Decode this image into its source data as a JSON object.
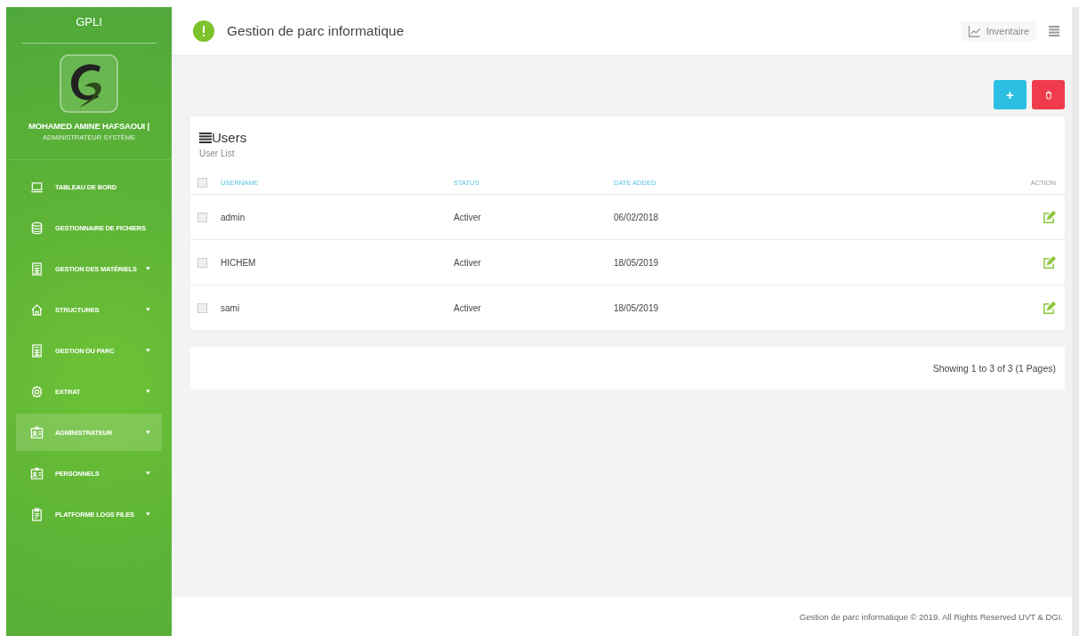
{
  "sidebar": {
    "brand": "GPLI",
    "user_name": "MOHAMED AMINE HAFSAOUI |",
    "user_role": "ADMINISTRATEUR SYSTÈME",
    "items": [
      {
        "label": "TABLEAU DE BORD",
        "kind": "laptop",
        "has_submenu": false,
        "selected": false
      },
      {
        "label": "GESTIONNAIRE DE FICHIERS",
        "kind": "database",
        "has_submenu": false,
        "selected": false
      },
      {
        "label": "GESTION DES MATÉRIELS",
        "kind": "calculator",
        "has_submenu": true,
        "selected": false
      },
      {
        "label": "STRUCTURES",
        "kind": "home",
        "has_submenu": true,
        "selected": false
      },
      {
        "label": "GESTION DU PARC",
        "kind": "calculator",
        "has_submenu": true,
        "selected": false
      },
      {
        "label": "EXTRAT",
        "kind": "gear",
        "has_submenu": true,
        "selected": false
      },
      {
        "label": "ADMINISTRATEUR",
        "kind": "badge",
        "has_submenu": true,
        "selected": true
      },
      {
        "label": "PERSONNELS",
        "kind": "badge",
        "has_submenu": true,
        "selected": false
      },
      {
        "label": "PLATFORME LOGS FILES",
        "kind": "clipboard",
        "has_submenu": true,
        "selected": false
      }
    ]
  },
  "header": {
    "title": "Gestion de parc informatique",
    "inventory_link": "Inventaire"
  },
  "toolbar": {
    "add_button": "+"
  },
  "card": {
    "title": "Users",
    "subtitle": "User List",
    "select_all_checked": false,
    "columns": [
      "USERNAME",
      "STATUS",
      "DATE ADDED",
      "ACTION"
    ],
    "rows": [
      {
        "username": "admin",
        "status": "Activer",
        "date_added": "06/02/2018",
        "checked": false
      },
      {
        "username": "HICHEM",
        "status": "Activer",
        "date_added": "18/05/2019",
        "checked": false
      },
      {
        "username": "sami",
        "status": "Activer",
        "date_added": "18/05/2019",
        "checked": false
      }
    ]
  },
  "pagination": "Showing 1 to 3 of 3 (1 Pages)",
  "footer": "Gestion de parc informatique © 2019. All Rights Reserved UVT & DGI."
}
